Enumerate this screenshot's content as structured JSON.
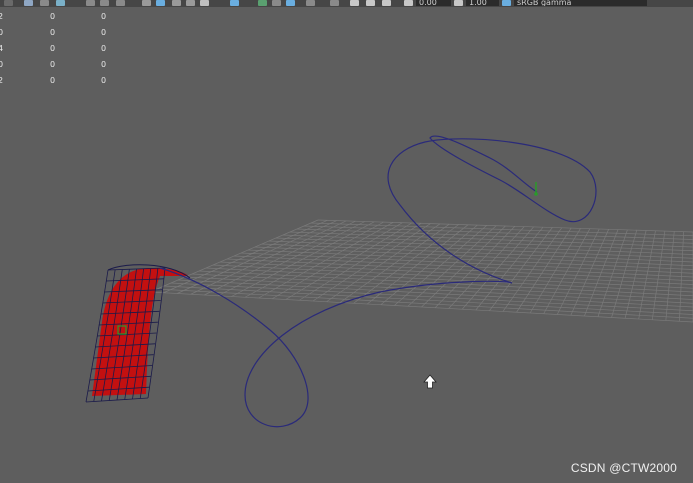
{
  "toolbar": {
    "exposure_value": "0.00",
    "gamma_value": "1.00",
    "color_space": "sRGB gamma"
  },
  "hud": {
    "rows": [
      {
        "label": "2",
        "col1": "0",
        "col2": "0"
      },
      {
        "label": "0",
        "col1": "0",
        "col2": "0"
      },
      {
        "label": "4",
        "col1": "0",
        "col2": "0"
      },
      {
        "label": "0",
        "col1": "0",
        "col2": "0"
      },
      {
        "label": "2",
        "col1": "0",
        "col2": "0"
      }
    ]
  },
  "watermark": "CSDN @CTW2000",
  "colors": {
    "viewport_bg": "#5e5e5e",
    "grid": "#7a7a7a",
    "curve": "#2a2a7a",
    "surface_fill": "#cc0a0a",
    "surface_wire": "#1a1a4a",
    "pivot": "#2a9a2a"
  }
}
